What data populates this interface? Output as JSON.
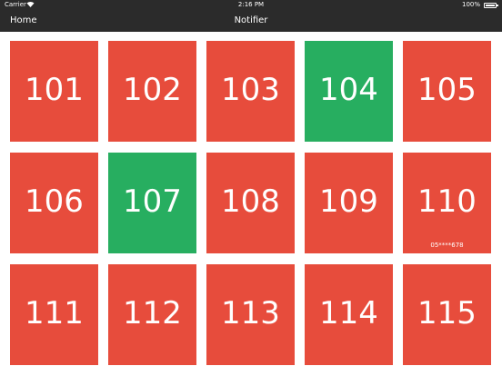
{
  "status_bar": {
    "carrier": "Carrier",
    "wifi_icon": "wifi-icon",
    "time": "2:16 PM",
    "battery_percent": "100%",
    "battery_icon": "battery-icon"
  },
  "nav": {
    "back_label": "Home",
    "title": "Notifier"
  },
  "colors": {
    "bar_bg": "#2b2b2b",
    "occupied": "#e74c3c",
    "available": "#27ae60"
  },
  "rooms": [
    {
      "number": "101",
      "status": "occupied",
      "note": ""
    },
    {
      "number": "102",
      "status": "occupied",
      "note": ""
    },
    {
      "number": "103",
      "status": "occupied",
      "note": ""
    },
    {
      "number": "104",
      "status": "available",
      "note": ""
    },
    {
      "number": "105",
      "status": "occupied",
      "note": ""
    },
    {
      "number": "106",
      "status": "occupied",
      "note": ""
    },
    {
      "number": "107",
      "status": "available",
      "note": ""
    },
    {
      "number": "108",
      "status": "occupied",
      "note": ""
    },
    {
      "number": "109",
      "status": "occupied",
      "note": ""
    },
    {
      "number": "110",
      "status": "occupied",
      "note": "05****678"
    },
    {
      "number": "111",
      "status": "occupied",
      "note": ""
    },
    {
      "number": "112",
      "status": "occupied",
      "note": ""
    },
    {
      "number": "113",
      "status": "occupied",
      "note": ""
    },
    {
      "number": "114",
      "status": "occupied",
      "note": ""
    },
    {
      "number": "115",
      "status": "occupied",
      "note": ""
    }
  ]
}
